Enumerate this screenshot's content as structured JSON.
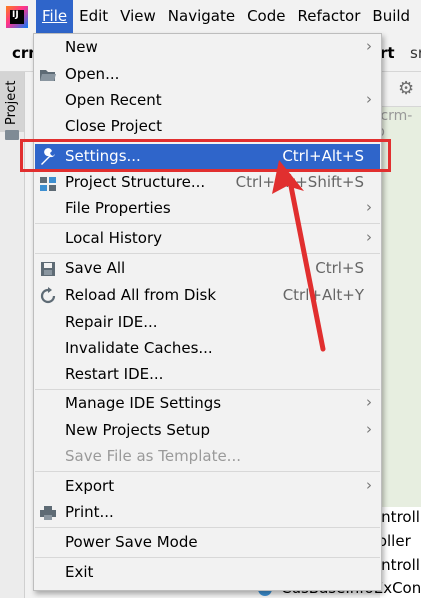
{
  "menubar": {
    "logo_text": "IJ",
    "items": [
      {
        "label": "File"
      },
      {
        "label": "Edit"
      },
      {
        "label": "View"
      },
      {
        "label": "Navigate"
      },
      {
        "label": "Code"
      },
      {
        "label": "Refactor"
      },
      {
        "label": "Build"
      }
    ]
  },
  "background": {
    "breadcrumb_left": "crm",
    "breadcrumb_right": "rt",
    "breadcrumb_right2": "sr",
    "sidebar_tab": "Project",
    "crm_hint": ",crm-b",
    "tree_lines": [
      "ontroll",
      "roller",
      "ontroll"
    ],
    "bottom_class": "CusBaseInfoExContr",
    "bottom_class_icon": "C"
  },
  "file_menu": {
    "items": [
      {
        "label": "New",
        "shortcut": "",
        "submenu": true,
        "icon": "",
        "disabled": false
      },
      {
        "label": "Open...",
        "shortcut": "",
        "submenu": false,
        "icon": "folder-open-icon",
        "disabled": false
      },
      {
        "label": "Open Recent",
        "shortcut": "",
        "submenu": true,
        "icon": "",
        "disabled": false
      },
      {
        "label": "Close Project",
        "shortcut": "",
        "submenu": false,
        "icon": "",
        "disabled": false
      },
      {
        "label": "Settings...",
        "shortcut": "Ctrl+Alt+S",
        "submenu": false,
        "icon": "wrench-icon",
        "disabled": false,
        "highlighted": true
      },
      {
        "label": "Project Structure...",
        "shortcut": "Ctrl+Alt+Shift+S",
        "submenu": false,
        "icon": "project-structure-icon",
        "disabled": false
      },
      {
        "label": "File Properties",
        "shortcut": "",
        "submenu": true,
        "icon": "",
        "disabled": false
      },
      {
        "label": "Local History",
        "shortcut": "",
        "submenu": true,
        "icon": "",
        "disabled": false
      },
      {
        "label": "Save All",
        "shortcut": "Ctrl+S",
        "submenu": false,
        "icon": "save-icon",
        "disabled": false
      },
      {
        "label": "Reload All from Disk",
        "shortcut": "Ctrl+Alt+Y",
        "submenu": false,
        "icon": "reload-icon",
        "disabled": false
      },
      {
        "label": "Repair IDE...",
        "shortcut": "",
        "submenu": false,
        "icon": "",
        "disabled": false
      },
      {
        "label": "Invalidate Caches...",
        "shortcut": "",
        "submenu": false,
        "icon": "",
        "disabled": false
      },
      {
        "label": "Restart IDE...",
        "shortcut": "",
        "submenu": false,
        "icon": "",
        "disabled": false
      },
      {
        "label": "Manage IDE Settings",
        "shortcut": "",
        "submenu": true,
        "icon": "",
        "disabled": false
      },
      {
        "label": "New Projects Setup",
        "shortcut": "",
        "submenu": true,
        "icon": "",
        "disabled": false
      },
      {
        "label": "Save File as Template...",
        "shortcut": "",
        "submenu": false,
        "icon": "",
        "disabled": true
      },
      {
        "label": "Export",
        "shortcut": "",
        "submenu": true,
        "icon": "",
        "disabled": false
      },
      {
        "label": "Print...",
        "shortcut": "",
        "submenu": false,
        "icon": "printer-icon",
        "disabled": false
      },
      {
        "label": "Power Save Mode",
        "shortcut": "",
        "submenu": false,
        "icon": "",
        "disabled": false
      },
      {
        "label": "Exit",
        "shortcut": "",
        "submenu": false,
        "icon": "",
        "disabled": false
      }
    ],
    "submenu_arrow": "›"
  },
  "annotation": {
    "box_color": "#e12f2f",
    "arrow_color": "#e12f2f"
  },
  "colors": {
    "highlight": "#2f65ca",
    "menu_bg": "#f2f2f2"
  }
}
